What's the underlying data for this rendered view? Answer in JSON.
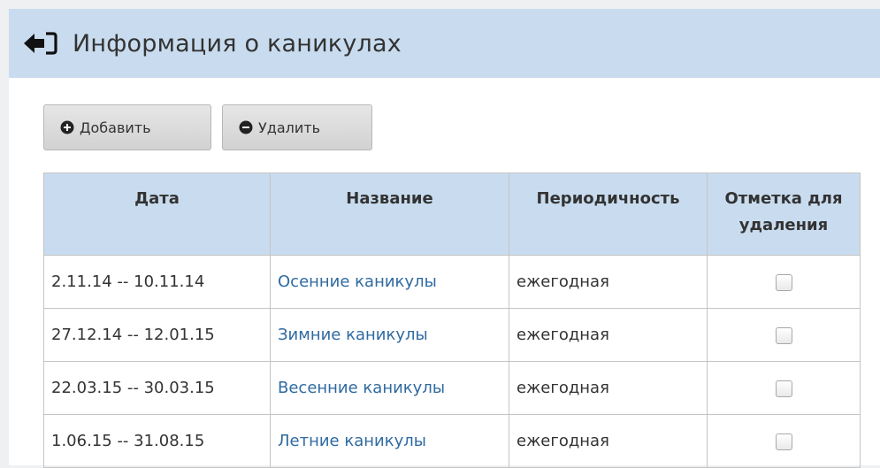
{
  "header": {
    "title": "Информация о каникулах",
    "back_icon": "sign-out-icon"
  },
  "toolbar": {
    "add_label": "Добавить",
    "add_icon": "plus-circle-icon",
    "remove_label": "Удалить",
    "remove_icon": "minus-circle-icon"
  },
  "table": {
    "columns": [
      "Дата",
      "Название",
      "Периодичность",
      "Отметка для удаления"
    ],
    "rows": [
      {
        "date": "2.11.14 -- 10.11.14",
        "name": "Осенние каникулы",
        "period": "ежегодная",
        "checked": false
      },
      {
        "date": "27.12.14 -- 12.01.15",
        "name": "Зимние каникулы",
        "period": "ежегодная",
        "checked": false
      },
      {
        "date": "22.03.15 -- 30.03.15",
        "name": "Весенние каникулы",
        "period": "ежегодная",
        "checked": false
      },
      {
        "date": "1.06.15 -- 31.08.15",
        "name": "Летние каникулы",
        "period": "ежегодная",
        "checked": false
      }
    ]
  },
  "colors": {
    "header_bg": "#c9dcef",
    "link": "#2f6aa0",
    "border": "#c4c4c4"
  }
}
